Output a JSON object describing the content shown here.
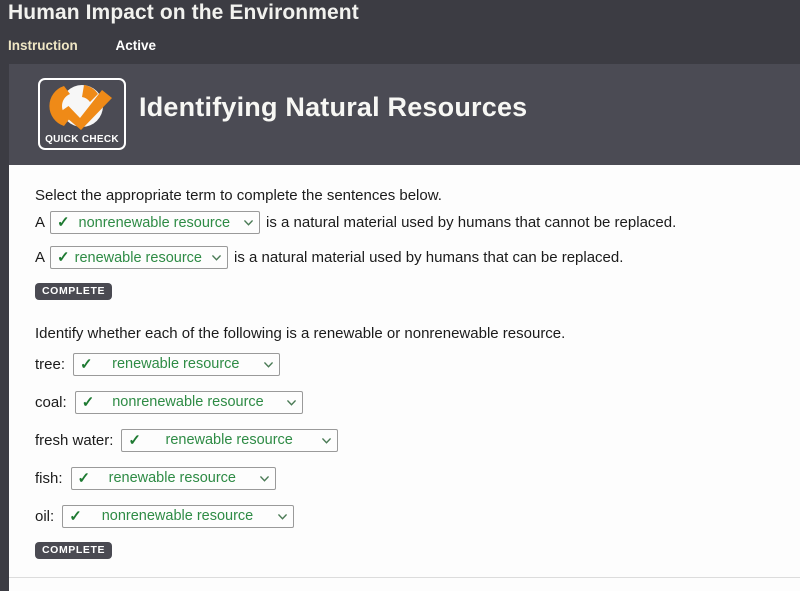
{
  "header": {
    "course_title": "Human Impact on the Environment",
    "breadcrumbs": [
      {
        "label": "Instruction",
        "color": "#efe6c4"
      },
      {
        "label": "Active",
        "color": "#ffffff"
      }
    ]
  },
  "lesson": {
    "badge_label": "QUICK CHECK",
    "badge_icon": "orange-checkmark-icon",
    "title": "Identifying Natural Resources"
  },
  "section1": {
    "instruction": "Select the appropriate term to complete the sentences below.",
    "sentences": [
      {
        "lead": "A",
        "selected": "nonrenewable resource",
        "tail": "is a natural material used by humans that cannot be replaced."
      },
      {
        "lead": "A",
        "selected": "renewable resource",
        "tail": "is a natural material used by humans that can be replaced."
      }
    ],
    "status": "COMPLETE"
  },
  "section2": {
    "instruction": "Identify whether each of the following is a renewable or nonrenewable resource.",
    "items": [
      {
        "label": "tree:",
        "selected": "renewable resource"
      },
      {
        "label": "coal:",
        "selected": "nonrenewable resource"
      },
      {
        "label": "fresh water:",
        "selected": "renewable resource"
      },
      {
        "label": "fish:",
        "selected": "renewable resource"
      },
      {
        "label": "oil:",
        "selected": "nonrenewable resource"
      }
    ],
    "status": "COMPLETE"
  },
  "symbols": {
    "check": "✓"
  },
  "colors": {
    "header_bg": "#3c3c43",
    "title_band_bg": "#4b4b54",
    "content_bg": "#fdfdfd",
    "answer_green": "#2e8b45",
    "check_green": "#1e7a32",
    "badge_orange": "#ef8a17",
    "breadcrumb_cream": "#efe6c4"
  }
}
